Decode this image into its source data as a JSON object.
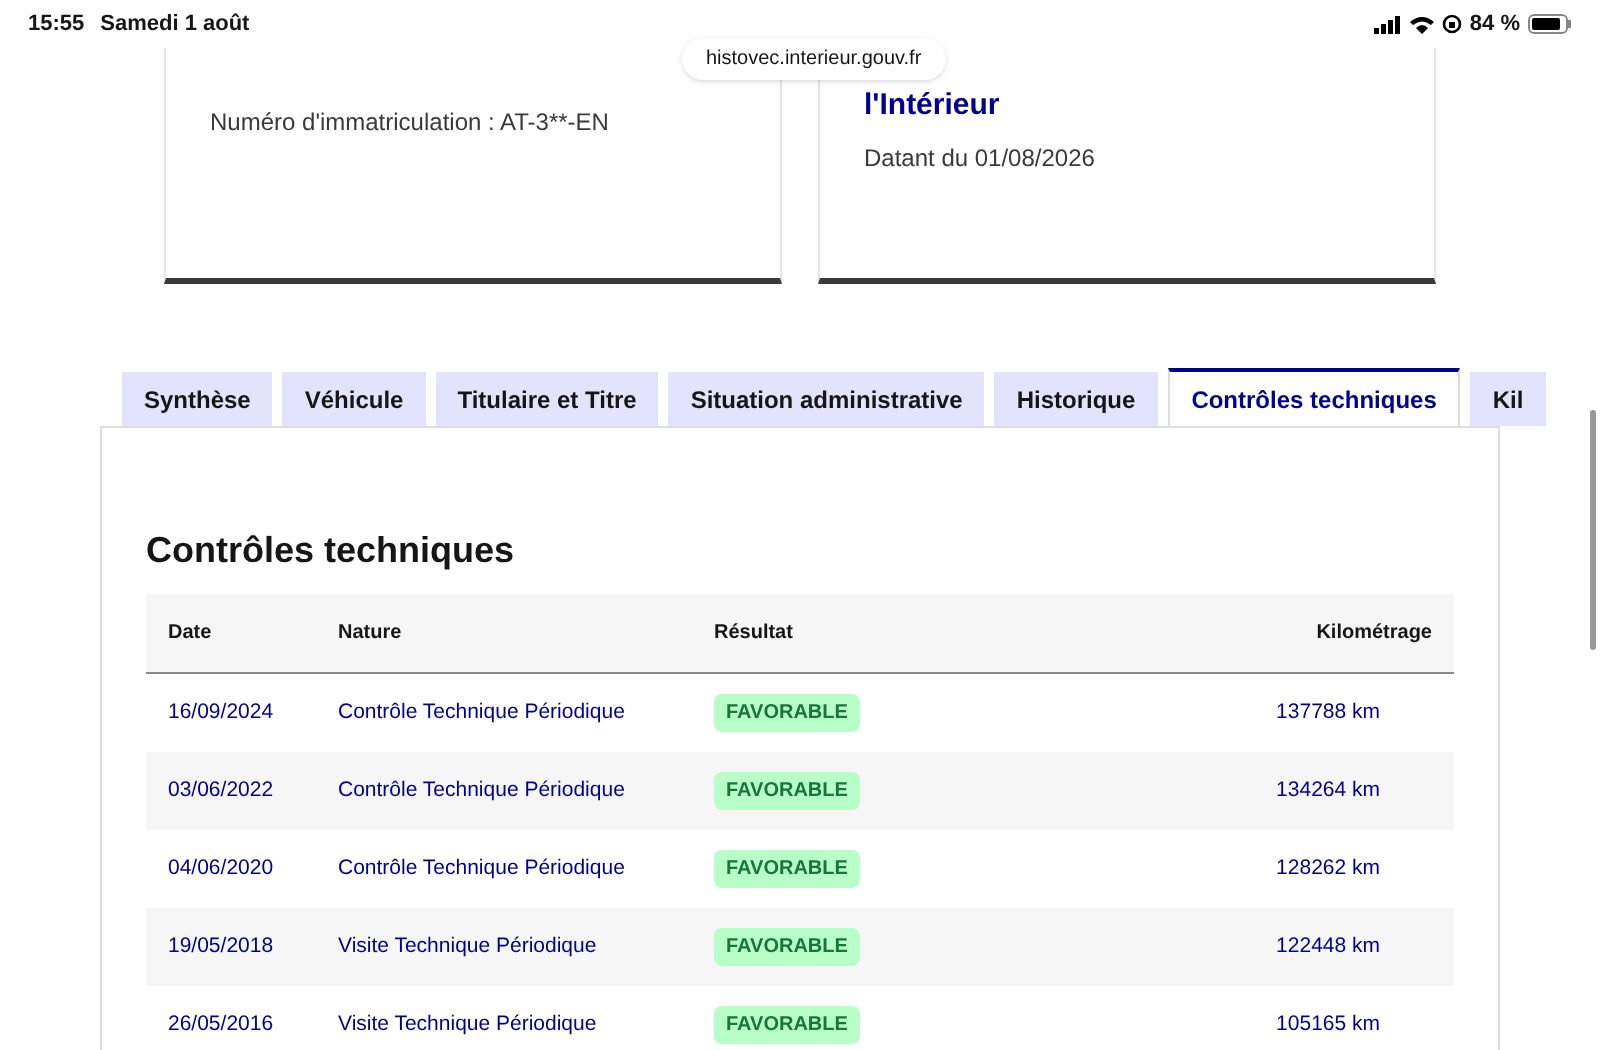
{
  "status_bar": {
    "time": "15:55",
    "date": "Samedi 1 août",
    "battery": "84 %"
  },
  "url": "histovec.interieur.gouv.fr",
  "cards": [
    {
      "text": "Numéro d'immatriculation : AT-3**-EN"
    },
    {
      "title": "l'Intérieur",
      "text": "Datant du 01/08/2026"
    }
  ],
  "tabs": [
    {
      "label": "Synthèse",
      "selected": false
    },
    {
      "label": "Véhicule",
      "selected": false
    },
    {
      "label": "Titulaire et Titre",
      "selected": false
    },
    {
      "label": "Situation administrative",
      "selected": false
    },
    {
      "label": "Historique",
      "selected": false
    },
    {
      "label": "Contrôles techniques",
      "selected": true
    },
    {
      "label": "Kil",
      "selected": false
    }
  ],
  "section_title": "Contrôles techniques",
  "table": {
    "columns": [
      "Date",
      "Nature",
      "Résultat",
      "Kilométrage"
    ],
    "rows": [
      {
        "date": "16/09/2024",
        "nature": "Contrôle Technique Périodique",
        "result": "FAVORABLE",
        "km": "137788 km"
      },
      {
        "date": "03/06/2022",
        "nature": "Contrôle Technique Périodique",
        "result": "FAVORABLE",
        "km": "134264 km"
      },
      {
        "date": "04/06/2020",
        "nature": "Contrôle Technique Périodique",
        "result": "FAVORABLE",
        "km": "128262 km"
      },
      {
        "date": "19/05/2018",
        "nature": "Visite Technique Périodique",
        "result": "FAVORABLE",
        "km": "122448 km"
      },
      {
        "date": "26/05/2016",
        "nature": "Visite Technique Périodique",
        "result": "FAVORABLE",
        "km": "105165 km"
      }
    ]
  }
}
